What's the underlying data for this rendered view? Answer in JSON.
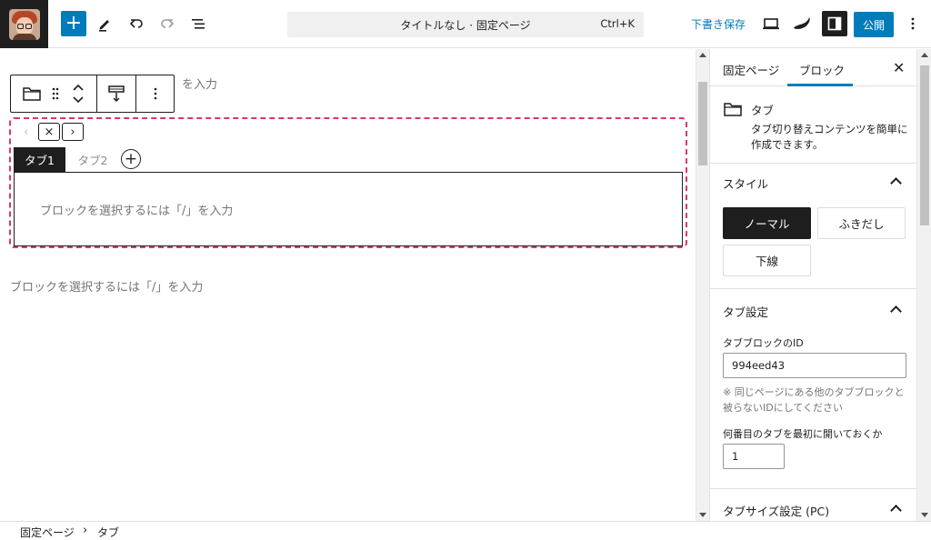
{
  "header": {
    "command_title": "タイトルなし · 固定ページ",
    "command_shortcut": "Ctrl+K",
    "save_draft": "下書き保存",
    "publish": "公開",
    "add_label": "+"
  },
  "editor": {
    "toolbar_trailing_text": "を入力",
    "placeholder": "ブロックを選択するには「/」を入力",
    "below_placeholder": "ブロックを選択するには「/」を入力",
    "nav_prev": "‹",
    "nav_close": "×",
    "nav_next": "›",
    "tabs": [
      "タブ1",
      "タブ2"
    ],
    "add_tab": "+"
  },
  "sidebar": {
    "tabs": [
      "固定ページ",
      "ブロック"
    ],
    "active_tab": "ブロック",
    "close": "✕",
    "block_name": "タブ",
    "block_description": "タブ切り替えコンテンツを簡単に作成できます。",
    "style_section": "スタイル",
    "styles": [
      "ノーマル",
      "ふきだし",
      "下線"
    ],
    "active_style": "ノーマル",
    "tab_settings_section": "タブ設定",
    "id_label": "タブブロックのID",
    "id_value": "994eed43",
    "id_help": "※ 同じページにある他のタブブロックと被らないIDにしてください",
    "open_index_label": "何番目のタブを最初に開いておくか",
    "open_index_value": "1",
    "size_section": "タブサイズ設定 (PC)"
  },
  "breadcrumb": {
    "items": [
      "固定ページ",
      "タブ"
    ],
    "separator": "›"
  },
  "colors": {
    "accent": "#007cba",
    "dark": "#1e1e1e",
    "selection_border": "#e0336d"
  }
}
